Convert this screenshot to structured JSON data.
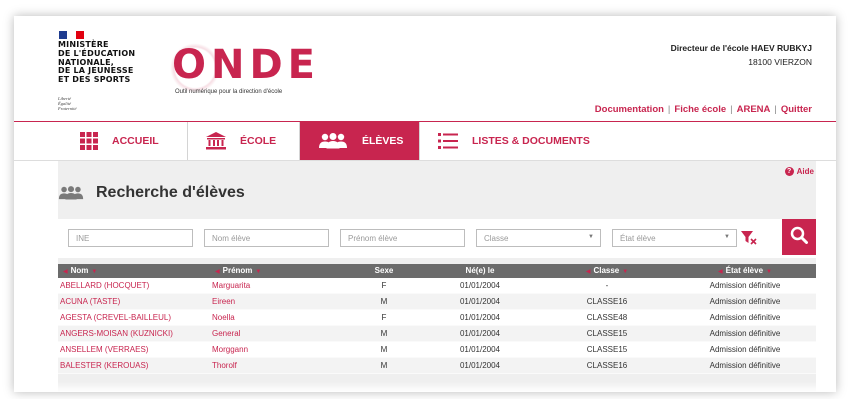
{
  "colors": {
    "accent": "#c8254f",
    "header_row": "#6b6b6b",
    "background": "#efefef"
  },
  "ministry": {
    "lines": [
      "MINISTÈRE",
      "DE L'ÉDUCATION",
      "NATIONALE,",
      "DE LA JEUNESSE",
      "ET DES SPORTS"
    ],
    "motto": [
      "Liberté",
      "Égalité",
      "Fraternité"
    ]
  },
  "logo": {
    "text": "ONDE",
    "subtitle": "Outil numérique pour la direction d'école"
  },
  "user": {
    "title": "Directeur de l'école HAEV RUBKYJ",
    "city": "18100 VIERZON"
  },
  "toplinks": [
    "Documentation",
    "Fiche école",
    "ARENA",
    "Quitter"
  ],
  "nav": [
    {
      "label": "ACCUEIL",
      "icon": "grid-icon"
    },
    {
      "label": "ÉCOLE",
      "icon": "school-building-icon"
    },
    {
      "label": "ÉLÈVES",
      "icon": "students-icon",
      "active": true
    },
    {
      "label": "LISTES & DOCUMENTS",
      "icon": "list-icon"
    }
  ],
  "aide": "Aide",
  "page_title": "Recherche d'élèves",
  "search": {
    "ine_placeholder": "INE",
    "nom_placeholder": "Nom élève",
    "prenom_placeholder": "Prénom élève",
    "classe_placeholder": "Classe",
    "etat_placeholder": "État élève"
  },
  "table": {
    "headers": [
      "Nom",
      "Prénom",
      "Sexe",
      "Né(e) le",
      "Classe",
      "État élève"
    ],
    "rows": [
      [
        "ABELLARD (HOCQUET)",
        "Marguarita",
        "F",
        "01/01/2004",
        "-",
        "Admission définitive"
      ],
      [
        "ACUNA (TASTE)",
        "Eireen",
        "M",
        "01/01/2004",
        "CLASSE16",
        "Admission définitive"
      ],
      [
        "AGESTA (CREVEL-BAILLEUL)",
        "Noella",
        "F",
        "01/01/2004",
        "CLASSE48",
        "Admission définitive"
      ],
      [
        "ANGERS-MOISAN (KUZNICKI)",
        "General",
        "M",
        "01/01/2004",
        "CLASSE15",
        "Admission définitive"
      ],
      [
        "ANSELLEM (VERRAES)",
        "Morggann",
        "M",
        "01/01/2004",
        "CLASSE15",
        "Admission définitive"
      ],
      [
        "BALESTER (KEROUAS)",
        "Thorolf",
        "M",
        "01/01/2004",
        "CLASSE16",
        "Admission définitive"
      ]
    ]
  }
}
